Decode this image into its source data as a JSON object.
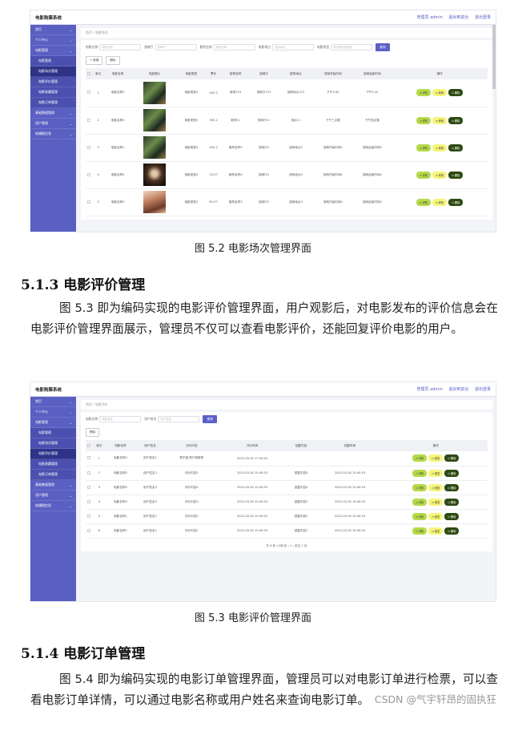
{
  "screenshot1": {
    "app_title": "电影购票系统",
    "top_links": [
      "管理员 admin",
      "退出到前台",
      "退出登录"
    ],
    "breadcrumb": "首页 / 电影场次",
    "sidebar": [
      {
        "label": "首页",
        "type": "top"
      },
      {
        "label": "个人中心",
        "type": "top"
      },
      {
        "label": "电影管理",
        "type": "top"
      },
      {
        "label": "电影管理",
        "type": "sub"
      },
      {
        "label": "电影场次管理",
        "type": "sub",
        "active": true
      },
      {
        "label": "电影评价管理",
        "type": "sub"
      },
      {
        "label": "电影收藏管理",
        "type": "sub"
      },
      {
        "label": "电影订单管理",
        "type": "sub"
      },
      {
        "label": "基础数据管理",
        "type": "top"
      },
      {
        "label": "用户管理",
        "type": "top"
      },
      {
        "label": "轮播图信息",
        "type": "top"
      }
    ],
    "filters": [
      {
        "label": "电影名称",
        "placeholder": "电影名称"
      },
      {
        "label": "放映厅",
        "placeholder": "放映厅"
      },
      {
        "label": "影院名称",
        "placeholder": "影院名称"
      },
      {
        "label": "电影地点",
        "placeholder": "电影地点"
      },
      {
        "label": "电影类型",
        "placeholder": "请选择电影类型"
      }
    ],
    "search_label": "查询",
    "add_label": "+ 新增",
    "delete_label": "删除",
    "columns": [
      "",
      "索引",
      "电影名称",
      "电影图片",
      "电影类型",
      "票价",
      "影院名称",
      "放映厅",
      "影院地点",
      "放映开始时间",
      "放映结束时间",
      "操作"
    ],
    "rows": [
      [
        "1",
        "电影名称3",
        "",
        "电影类型4",
        "405.2",
        "影院123",
        "放映厅123",
        "放映地点123",
        "下午3:35",
        "下午5:15"
      ],
      [
        "2",
        "电影名称5",
        "",
        "电影类型3",
        "305.2",
        "影院11",
        "放映厅11",
        "地点11",
        "下午三点整",
        "下午四点整"
      ],
      [
        "3",
        "电影名称1",
        "",
        "电影类型4",
        "425.2",
        "影院名称5",
        "放映厅5",
        "放映地点5",
        "放映开始时间5",
        "放映结束时间5"
      ],
      [
        "4",
        "电影名称4",
        "",
        "电影类型4",
        "25.57",
        "影院名称4",
        "放映厅4",
        "放映地点4",
        "放映开始时间4",
        "放映结束时间4"
      ],
      [
        "5",
        "电影名称3",
        "",
        "电影类型2",
        "81.97",
        "影院名称3",
        "放映厅3",
        "放映地点3",
        "放映开始时间3",
        "放映结束时间3"
      ]
    ],
    "row_actions": [
      "详情",
      "修改",
      "删除"
    ]
  },
  "caption1": "图 5.2 电影场次管理界面",
  "heading": "5.1.3 电影评价管理",
  "paragraph1": "图 5.3 即为编码实现的电影评价管理界面，用户观影后，对电影发布的评价信息会在电影评价管理界面展示，管理员不仅可以查看电影评价，还能回复评价电影的用户。",
  "screenshot2": {
    "app_title": "电影购票系统",
    "top_links": [
      "管理员 admin",
      "退出到前台",
      "退出登录"
    ],
    "breadcrumb": "首页 / 电影评价",
    "sidebar": [
      {
        "label": "首页",
        "type": "top"
      },
      {
        "label": "个人中心",
        "type": "top"
      },
      {
        "label": "电影管理",
        "type": "top"
      },
      {
        "label": "电影管理",
        "type": "sub"
      },
      {
        "label": "电影场次管理",
        "type": "sub"
      },
      {
        "label": "电影评价管理",
        "type": "sub",
        "active": true
      },
      {
        "label": "电影收藏管理",
        "type": "sub"
      },
      {
        "label": "电影订单管理",
        "type": "sub"
      },
      {
        "label": "基础数据管理",
        "type": "top"
      },
      {
        "label": "用户管理",
        "type": "top"
      },
      {
        "label": "轮播图信息",
        "type": "top"
      }
    ],
    "filters": [
      {
        "label": "电影名称",
        "placeholder": "电影名称"
      },
      {
        "label": "用户姓名",
        "placeholder": "用户姓名"
      }
    ],
    "search_label": "查询",
    "delete_label": "删除",
    "columns": [
      "",
      "索引",
      "电影名称",
      "用户姓名",
      "评价内容",
      "评价时间",
      "回复内容",
      "回复时间",
      "操作"
    ],
    "rows": [
      [
        "1",
        "电影名称4",
        "用户姓名1",
        "很不错,很兴奋推荐",
        "2022-03-30 17:00:45",
        "",
        ""
      ],
      [
        "2",
        "电影名称5",
        "用户姓名3",
        "评价内容5",
        "2022-03-30 15:40:53",
        "回复内容5",
        "2022-03-30 15:40:53"
      ],
      [
        "3",
        "电影名称4",
        "用户姓名3",
        "评价内容4",
        "2022-03-30 15:40:53",
        "回复内容4",
        "2022-03-30 15:40:53"
      ],
      [
        "4",
        "电影名称3",
        "用户姓名3",
        "评价内容3",
        "2022-03-30 15:40:53",
        "回复内容3",
        "2022-03-30 15:40:53"
      ],
      [
        "5",
        "电影名称1",
        "用户姓名2",
        "评价内容2",
        "2022-03-30 15:40:53",
        "回复内容2",
        "2022-03-30 15:40:53"
      ],
      [
        "6",
        "电影名称1",
        "用户姓名2",
        "评价内容1",
        "2022-03-30 15:40:53",
        "回复内容1",
        "2022-03-30 15:40:53"
      ]
    ],
    "row_actions": [
      "详情",
      "回复",
      "删除"
    ],
    "pager": "共 6 条 10条/页 ‹ 1 › 前往 1 页"
  },
  "caption2": "图 5.3 电影评价管理界面",
  "heading2": "5.1.4 电影订单管理",
  "paragraph2": "图 5.4 即为编码实现的电影订单管理界面，管理员可以对电影订单进行检票，可以查看电影订单详情，可以通过电影名称或用户姓名来查询电影订单。",
  "watermark": "CSDN @气宇轩昂的固执狂"
}
